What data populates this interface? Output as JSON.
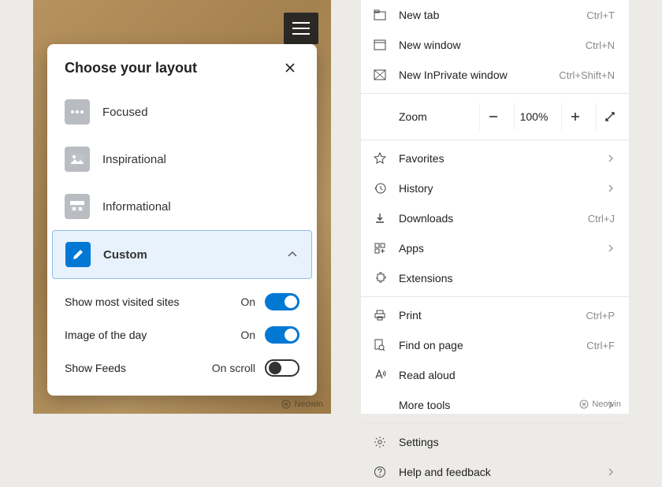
{
  "layoutCard": {
    "title": "Choose your layout",
    "options": [
      {
        "label": "Focused"
      },
      {
        "label": "Inspirational"
      },
      {
        "label": "Informational"
      },
      {
        "label": "Custom"
      }
    ],
    "settings": {
      "mostVisited": {
        "label": "Show most visited sites",
        "state": "On"
      },
      "imageOfDay": {
        "label": "Image of the day",
        "state": "On"
      },
      "showFeeds": {
        "label": "Show Feeds",
        "state": "On scroll"
      }
    }
  },
  "menu": {
    "newTab": {
      "label": "New tab",
      "shortcut": "Ctrl+T"
    },
    "newWindow": {
      "label": "New window",
      "shortcut": "Ctrl+N"
    },
    "newInPrivate": {
      "label": "New InPrivate window",
      "shortcut": "Ctrl+Shift+N"
    },
    "zoom": {
      "label": "Zoom",
      "value": "100%"
    },
    "favorites": {
      "label": "Favorites"
    },
    "history": {
      "label": "History"
    },
    "downloads": {
      "label": "Downloads",
      "shortcut": "Ctrl+J"
    },
    "apps": {
      "label": "Apps"
    },
    "extensions": {
      "label": "Extensions"
    },
    "print": {
      "label": "Print",
      "shortcut": "Ctrl+P"
    },
    "findOnPage": {
      "label": "Find on page",
      "shortcut": "Ctrl+F"
    },
    "readAloud": {
      "label": "Read aloud"
    },
    "moreTools": {
      "label": "More tools"
    },
    "settings": {
      "label": "Settings"
    },
    "help": {
      "label": "Help and feedback"
    }
  },
  "watermark": "Neowin"
}
